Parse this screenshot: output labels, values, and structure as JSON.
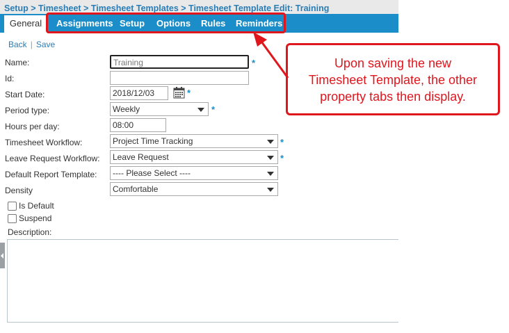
{
  "breadcrumb": "Setup > Timesheet > Timesheet Templates > Timesheet Template Edit: Training",
  "tabs": [
    {
      "label": "General",
      "active": true
    },
    {
      "label": "Assignments"
    },
    {
      "label": "Setup"
    },
    {
      "label": "Options"
    },
    {
      "label": "Rules"
    },
    {
      "label": "Reminders"
    }
  ],
  "actions": {
    "back": "Back",
    "separator": "|",
    "save": "Save"
  },
  "form": {
    "name": {
      "label": "Name:",
      "value": "Training"
    },
    "id": {
      "label": "Id:",
      "value": ""
    },
    "start_date": {
      "label": "Start Date:",
      "value": "2018/12/03"
    },
    "period_type": {
      "label": "Period type:",
      "value": "Weekly"
    },
    "hours_per_day": {
      "label": "Hours per day:",
      "value": "08:00"
    },
    "timesheet_workflow": {
      "label": "Timesheet Workflow:",
      "value": "Project Time Tracking"
    },
    "leave_request_workflow": {
      "label": "Leave Request Workflow:",
      "value": "Leave Request"
    },
    "default_report_template": {
      "label": "Default Report Template:",
      "value": "---- Please Select ----"
    },
    "density": {
      "label": "Density",
      "value": "Comfortable"
    },
    "is_default": {
      "label": "Is Default",
      "checked": false
    },
    "suspend": {
      "label": "Suspend",
      "checked": false
    },
    "description": {
      "label": "Description:",
      "value": ""
    },
    "required_marker": "*"
  },
  "callout": {
    "line1": "Upon saving the new",
    "line2": "Timesheet Template, the other",
    "line3": "property tabs then display."
  },
  "colors": {
    "accent": "#1b8dc8",
    "annotation": "#e0161d",
    "link": "#2a7db5"
  },
  "icons": {
    "calendar": "calendar-icon",
    "dropdown": "chevron-down-icon"
  }
}
